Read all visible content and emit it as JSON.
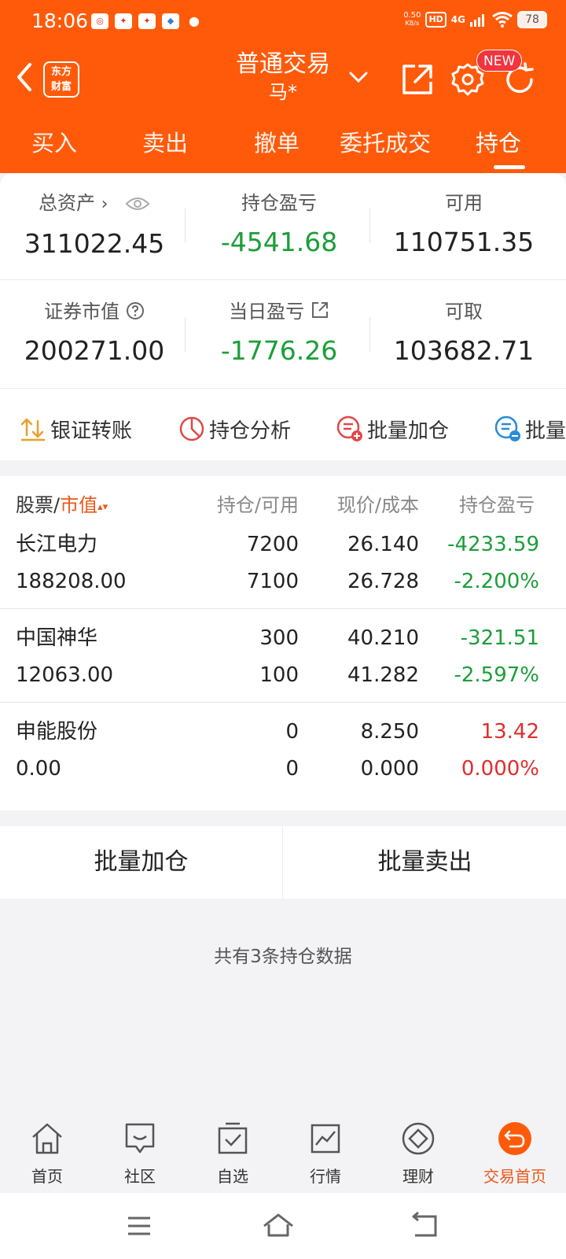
{
  "status_bar": {
    "time": "18:06",
    "net_speed_value": "0.50",
    "net_speed_unit": "KB/s",
    "hd": "HD",
    "network": "4G",
    "battery": "78"
  },
  "header": {
    "logo_text_line1": "东方",
    "logo_text_line2": "财富",
    "title": "普通交易",
    "account": "马*",
    "new_badge": "NEW"
  },
  "tabs": [
    {
      "label": "买入"
    },
    {
      "label": "卖出"
    },
    {
      "label": "撤单"
    },
    {
      "label": "委托成交"
    },
    {
      "label": "持仓"
    }
  ],
  "summary_stats": {
    "total_assets_label": "总资产",
    "total_assets_value": "311022.45",
    "position_pl_label": "持仓盈亏",
    "position_pl_value": "-4541.68",
    "available_label": "可用",
    "available_value": "110751.35",
    "market_value_label": "证券市值",
    "market_value_value": "200271.00",
    "daily_pl_label": "当日盈亏",
    "daily_pl_value": "-1776.26",
    "withdrawable_label": "可取",
    "withdrawable_value": "103682.71"
  },
  "quick_actions": [
    {
      "label": "银证转账",
      "icon": "transfer-icon"
    },
    {
      "label": "持仓分析",
      "icon": "pie-chart-icon"
    },
    {
      "label": "批量加仓",
      "icon": "batch-add-icon"
    },
    {
      "label": "批量",
      "icon": "batch-icon"
    }
  ],
  "table": {
    "headers": {
      "stock": "股票/",
      "market_value": "市值",
      "position": "持仓/可用",
      "price": "现价/成本",
      "pl": "持仓盈亏"
    },
    "rows": [
      {
        "name": "长江电力",
        "market_value": "188208.00",
        "position": "7200",
        "available": "7100",
        "price": "26.140",
        "cost": "26.728",
        "pl": "-4233.59",
        "pl_pct": "-2.200%"
      },
      {
        "name": "中国神华",
        "market_value": "12063.00",
        "position": "300",
        "available": "100",
        "price": "40.210",
        "cost": "41.282",
        "pl": "-321.51",
        "pl_pct": "-2.597%"
      },
      {
        "name": "申能股份",
        "market_value": "0.00",
        "position": "0",
        "available": "0",
        "price": "8.250",
        "cost": "0.000",
        "pl": "13.42",
        "pl_pct": "0.000%"
      }
    ]
  },
  "batch_buttons": {
    "add": "批量加仓",
    "sell": "批量卖出"
  },
  "summary_text": "共有3条持仓数据",
  "bottom_nav": [
    {
      "label": "首页",
      "icon": "home-icon"
    },
    {
      "label": "社区",
      "icon": "community-icon"
    },
    {
      "label": "自选",
      "icon": "watchlist-icon"
    },
    {
      "label": "行情",
      "icon": "market-icon"
    },
    {
      "label": "理财",
      "icon": "wealth-icon"
    },
    {
      "label": "交易首页",
      "icon": "trade-home-icon"
    }
  ],
  "colors": {
    "brand_orange": "#ff5a0a",
    "loss_green": "#1c9e3a",
    "gain_red": "#e02e2e",
    "new_badge_red": "#f2343f"
  }
}
